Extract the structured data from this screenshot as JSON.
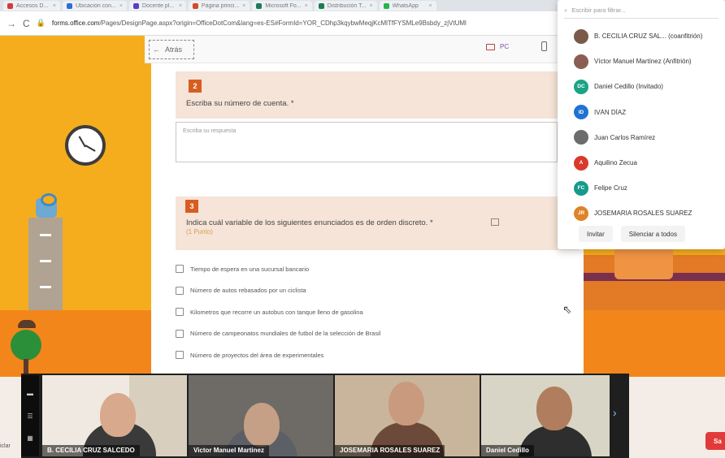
{
  "browser": {
    "tabs": [
      {
        "label": "Accesos D...",
        "color": "#d43b3b"
      },
      {
        "label": "Ubicación con...",
        "color": "#2b6fd6"
      },
      {
        "label": "Docente pl...",
        "color": "#5a3fc4"
      },
      {
        "label": "Página princi...",
        "color": "#d44a2a"
      },
      {
        "label": "Microsoft Fo...",
        "color": "#1b7a5a"
      },
      {
        "label": "Distribución T...",
        "color": "#1f7c4d"
      },
      {
        "label": "WhatsApp",
        "color": "#2ab34a"
      }
    ],
    "url_host": "forms.office.com",
    "url_path": "/Pages/DesignPage.aspx?origin=OfficeDotCom&lang=es-ES#FormId=YOR_CDhp3kqybwMeqjKcMlTfFYSMLe9Bsbdy_zjVtUMl"
  },
  "toolbar": {
    "back_label": "Atrás",
    "pc_label": "PC"
  },
  "form": {
    "q2": {
      "number": "2",
      "text": "Escriba su número de cuenta. *"
    },
    "answer_placeholder": "Escriba su respuesta",
    "q3": {
      "number": "3",
      "text": "Indica cuál variable de los siguientes enunciados es de orden discreto. *",
      "points": "(1 Punto)"
    },
    "options": [
      "Tiempo de espera en una sucursal bancario",
      "Número de autos rebasados por un ciclista",
      "Kilometros que recorre un autobus con tanque lleno de gasolina",
      "Número de campeonatos mundiales de futbol de la selección de Brasil",
      "Número de proyectos del área de experimentales"
    ]
  },
  "participants": {
    "filter_placeholder": "Escribir para filtrar...",
    "list": [
      {
        "name": "B. CECILIA CRUZ SAL... (coanfitrión)",
        "initials": "",
        "color": "#7a5a4a"
      },
      {
        "name": "Víctor Manuel Martínez (Anfitrión)",
        "initials": "",
        "color": "#8a5e52"
      },
      {
        "name": "Daniel Cedillo (Invitado)",
        "initials": "DC",
        "color": "#1aa386"
      },
      {
        "name": "IVÁN DÍAZ",
        "initials": "ID",
        "color": "#1f74d1"
      },
      {
        "name": "Juan Carlos Ramírez",
        "initials": "",
        "color": "#6c6c6c"
      },
      {
        "name": "Aquilino Zecua",
        "initials": "A",
        "color": "#d93a2b"
      },
      {
        "name": "Felipe Cruz",
        "initials": "FC",
        "color": "#159b8a"
      },
      {
        "name": "JOSEMARIA ROSALES SUAREZ",
        "initials": "JR",
        "color": "#e0822a"
      }
    ],
    "invite_label": "Invitar",
    "mute_all_label": "Silenciar a todos"
  },
  "video": {
    "tiles": [
      {
        "name": "B. CECILIA CRUZ SALCEDO"
      },
      {
        "name": "Victor Manuel Martinez"
      },
      {
        "name": "JOSEMARIA ROSALES SUAREZ"
      },
      {
        "name": "Daniel Cedillo"
      }
    ],
    "side_label": "iclar",
    "corner_label": "Sa"
  }
}
